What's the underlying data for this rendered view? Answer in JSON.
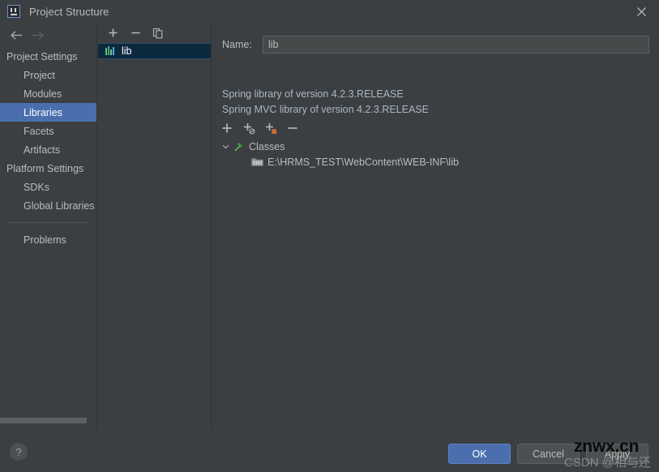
{
  "window": {
    "title": "Project Structure",
    "app_icon": "intellij-idea-icon",
    "close_icon": "close-icon"
  },
  "nav": {
    "back_icon": "arrow-left-icon",
    "forward_icon": "arrow-right-icon"
  },
  "sidebar": {
    "items": [
      {
        "label": "Project Settings",
        "type": "group",
        "selected": false
      },
      {
        "label": "Project",
        "type": "child",
        "selected": false
      },
      {
        "label": "Modules",
        "type": "child",
        "selected": false
      },
      {
        "label": "Libraries",
        "type": "child",
        "selected": true
      },
      {
        "label": "Facets",
        "type": "child",
        "selected": false
      },
      {
        "label": "Artifacts",
        "type": "child",
        "selected": false
      },
      {
        "label": "Platform Settings",
        "type": "group",
        "selected": false
      },
      {
        "label": "SDKs",
        "type": "child",
        "selected": false
      },
      {
        "label": "Global Libraries",
        "type": "child",
        "selected": false
      },
      {
        "label": "Problems",
        "type": "child",
        "selected": false
      }
    ],
    "selection_color": "#4b6eaf"
  },
  "library_panel": {
    "toolbar": [
      {
        "name": "add-library-button",
        "icon": "plus-icon"
      },
      {
        "name": "remove-library-button",
        "icon": "minus-icon"
      },
      {
        "name": "copy-library-button",
        "icon": "copy-icon"
      }
    ],
    "items": [
      {
        "label": "lib",
        "icon": "library-icon",
        "selected": true
      }
    ]
  },
  "detail": {
    "name_label": "Name:",
    "name_value": "lib",
    "descriptions": [
      "Spring library of version 4.2.3.RELEASE",
      "Spring MVC library of version 4.2.3.RELEASE"
    ],
    "toolbar": [
      {
        "name": "add-root-button",
        "icon": "plus-icon"
      },
      {
        "name": "attach-url-button",
        "icon": "plus-globe-icon"
      },
      {
        "name": "attach-jar-button",
        "icon": "plus-jar-icon"
      },
      {
        "name": "remove-root-button",
        "icon": "minus-icon"
      }
    ],
    "tree": [
      {
        "label": "Classes",
        "level": 1,
        "icon": "classes-hammer-icon",
        "expanded": true,
        "twisty": "chevron-down-icon"
      },
      {
        "label": "E:\\HRMS_TEST\\WebContent\\WEB-INF\\lib",
        "level": 2,
        "icon": "jar-folder-icon",
        "expanded": false,
        "twisty": ""
      }
    ]
  },
  "footer": {
    "help_label": "?",
    "ok_label": "OK",
    "cancel_label": "Cancel",
    "apply_label": "Apply"
  },
  "watermark": {
    "main": "znwx.cn",
    "sub": "CSDN @相与还"
  },
  "colors": {
    "background": "#3c3f41",
    "accent": "#4b6eaf",
    "text": "#bbbbbb",
    "tree_selection": "#0d293e"
  }
}
